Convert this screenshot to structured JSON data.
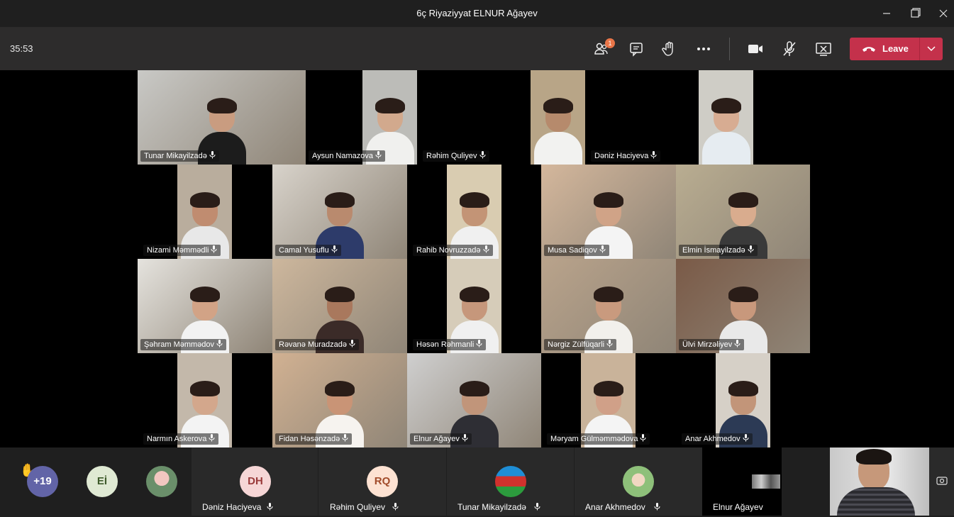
{
  "window": {
    "title": "6ç Riyaziyyat ELNUR Ağayev"
  },
  "toolbar": {
    "timer": "35:53",
    "participants_badge": "1",
    "leave_label": "Leave"
  },
  "icons": {
    "participants": "people-icon",
    "chat": "chat-icon",
    "raise_hand": "hand-icon",
    "more": "more-icon",
    "camera": "camera-icon",
    "mic": "mic-off-icon",
    "share": "share-screen-icon",
    "leave": "phone-hangup-icon"
  },
  "colors": {
    "leave": "#c4314b",
    "badge": "#e97548",
    "toolbar": "#2d2c2c",
    "titlebar": "#1f1f1f",
    "avatar_purple": "#6264a7"
  },
  "participants": [
    {
      "name": "Tunar Mikayilzadə"
    },
    {
      "name": "Aysun Namazova"
    },
    {
      "name": "Rəhim Quliyev"
    },
    {
      "name": "Dəniz Haciyeva"
    },
    {
      "name": "Nizami Məmmədli"
    },
    {
      "name": "Camal Yusuflu"
    },
    {
      "name": "Rahib Novruzzadə"
    },
    {
      "name": "Musa Sadiqov"
    },
    {
      "name": "Elmin İsmayilzadə"
    },
    {
      "name": "Şəhram Məmmədov"
    },
    {
      "name": "Rəvanə Muradzadə"
    },
    {
      "name": "Həsən Rəhmanli"
    },
    {
      "name": "Nərgiz Zülfüqarli"
    },
    {
      "name": "Ülvi Mirzəliyev"
    },
    {
      "name": "Narmın Askerova"
    },
    {
      "name": "Fidan Həsənzadə"
    },
    {
      "name": "Elnur Ağayev"
    },
    {
      "name": "Məryam Gülməmmədova"
    },
    {
      "name": "Anar Akhmedov"
    }
  ],
  "strip": {
    "overflow_count": "+19",
    "items": [
      {
        "initials": "Eİ",
        "name": ""
      },
      {
        "initials": "",
        "name": ""
      },
      {
        "initials": "DH",
        "name": "Dəniz Haciyeva"
      },
      {
        "initials": "RQ",
        "name": "Rəhim Quliyev"
      },
      {
        "initials": "",
        "name": "Tunar Mikayilzadə"
      },
      {
        "initials": "",
        "name": "Anar Akhmedov"
      },
      {
        "initials": "",
        "name": "Elnur Ağayev"
      }
    ]
  }
}
